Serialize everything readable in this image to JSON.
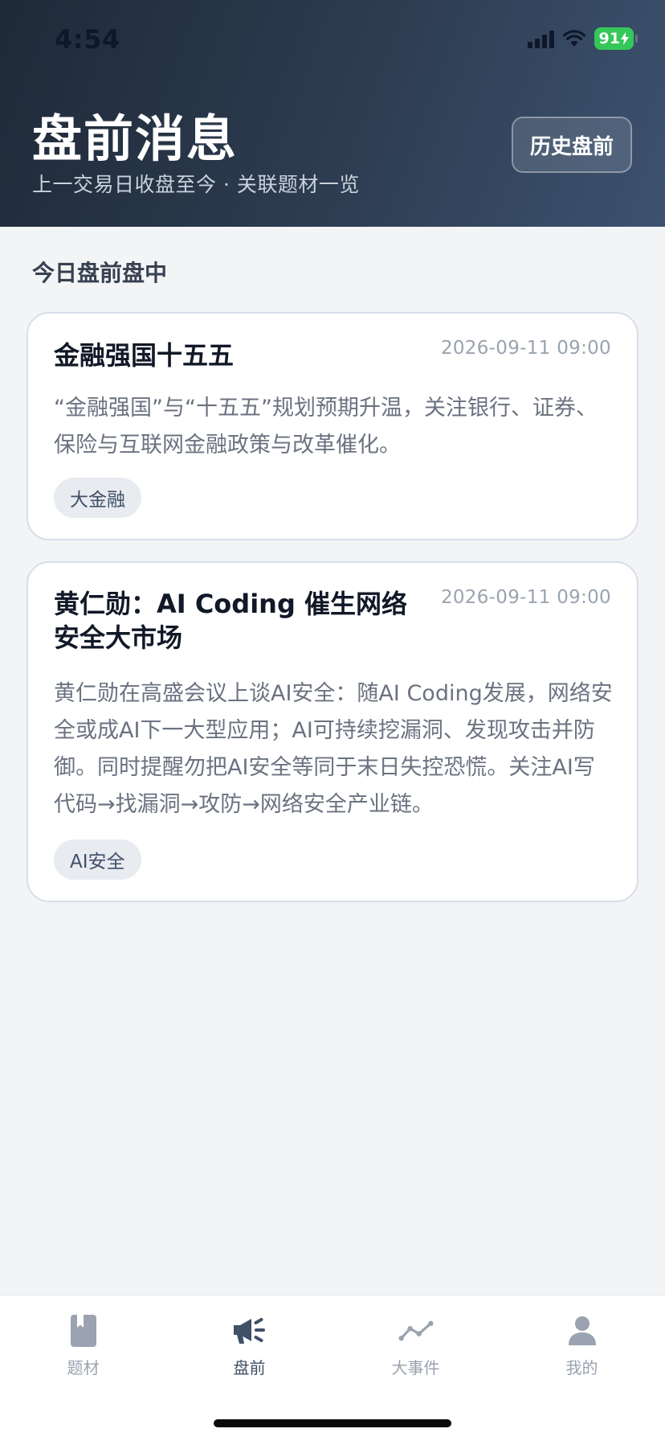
{
  "status_bar": {
    "time": "4:54",
    "battery": "91"
  },
  "header": {
    "title": "盘前消息",
    "subtitle": "上一交易日收盘至今 · 关联题材一览",
    "history_button": "历史盘前"
  },
  "section_title": "今日盘前盘中",
  "cards": [
    {
      "title": "金融强国十五五",
      "time": "2026-09-11 09:00",
      "body": "“金融强国”与“十五五”规划预期升温，关注银行、证券、保险与互联网金融政策与改革催化。",
      "tag": "大金融"
    },
    {
      "title": "黄仁勋：AI Coding 催生网络安全大市场",
      "time": "2026-09-11 09:00",
      "body": "黄仁勋在高盛会议上谈AI安全：随AI Coding发展，网络安全或成AI下一大型应用；AI可持续挖漏洞、发现攻击并防御。同时提醒勿把AI安全等同于末日失控恐慌。关注AI写代码→找漏洞→攻防→网络安全产业链。",
      "tag": "AI安全"
    }
  ],
  "tabbar": {
    "items": [
      {
        "label": "题材",
        "icon": "book-icon"
      },
      {
        "label": "盘前",
        "icon": "megaphone-icon"
      },
      {
        "label": "大事件",
        "icon": "trend-line-icon"
      },
      {
        "label": "我的",
        "icon": "user-icon"
      }
    ],
    "active_index": 1
  },
  "colors": {
    "accent": "#3f5068",
    "inactive": "#9aa3af",
    "battery": "#34c759"
  }
}
